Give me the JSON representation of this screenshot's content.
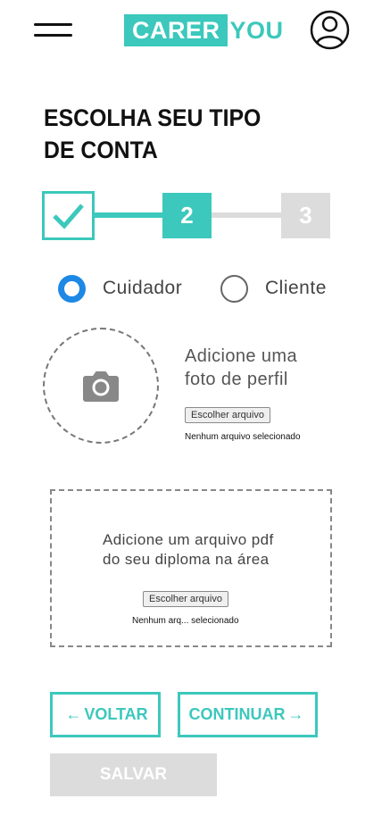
{
  "header": {
    "logo_part1": "CARER",
    "logo_part2": "YOU",
    "menu_icon": "hamburger-menu-icon",
    "profile_icon": "user-avatar-icon"
  },
  "page": {
    "title_line1": "ESCOLHA SEU TIPO",
    "title_line2": "DE CONTA"
  },
  "stepper": {
    "step1_icon": "checkmark-icon",
    "step2_label": "2",
    "step3_label": "3"
  },
  "account_type": {
    "options": [
      {
        "label": "Cuidador",
        "selected": true
      },
      {
        "label": "Cliente",
        "selected": false
      }
    ]
  },
  "photo_upload": {
    "icon": "camera-icon",
    "text_line1": "Adicione uma",
    "text_line2": "foto de perfil",
    "button_label": "Escolher arquivo",
    "status": "Nenhum arquivo selecionado"
  },
  "diploma_upload": {
    "text_line1": "Adicione um arquivo pdf",
    "text_line2": "do seu diploma na área",
    "button_label": "Escolher arquivo",
    "status": "Nenhum arq... selecionado"
  },
  "actions": {
    "back_label": "VOLTAR",
    "continue_label": "CONTINUAR",
    "save_label": "SALVAR"
  },
  "colors": {
    "brand": "#3cc8bc",
    "radio_selected": "#1e88e5",
    "disabled": "#dcdcdc"
  }
}
